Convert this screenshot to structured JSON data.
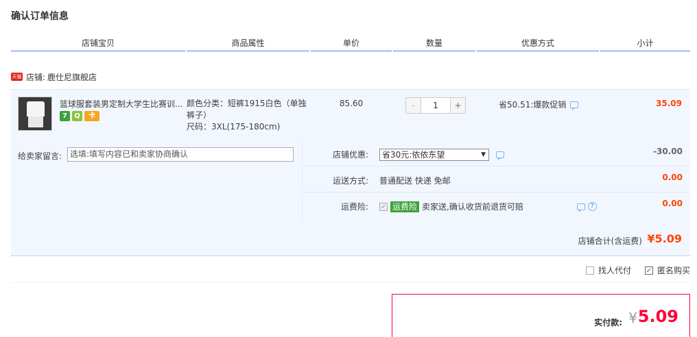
{
  "page": {
    "title": "确认订单信息"
  },
  "columns": [
    "店铺宝贝",
    "商品属性",
    "单价",
    "数量",
    "优惠方式",
    "小计"
  ],
  "shop": {
    "badge": "天猫",
    "label": "店铺:",
    "name": "鹿仕尼旗舰店"
  },
  "item": {
    "name": "篮球服套装男定制大学生比赛训...",
    "tags": [
      "7",
      "Q",
      "卡"
    ],
    "color_prop": "颜色分类：短裤1915白色（单独裤子）",
    "size_prop": "尺码：3XL(175-180cm)",
    "price": "85.60",
    "quantity": "1",
    "qty_minus": "-",
    "qty_plus": "+",
    "promo": "省50.51:爆款促销",
    "subtotal": "35.09"
  },
  "memo": {
    "label": "给卖家留言:",
    "placeholder": "选填:填写内容已和卖家协商确认"
  },
  "options": {
    "discount": {
      "label": "店铺优惠:",
      "selected": "省30元:依依东望",
      "amount": "-30.00"
    },
    "shipping": {
      "label": "运送方式:",
      "value": "普通配送 快递 免邮",
      "amount": "0.00"
    },
    "insurance": {
      "label": "运费险:",
      "badge": "运费险",
      "text": "卖家送,确认收货前退货可赔",
      "amount": "0.00"
    }
  },
  "shop_total": {
    "label": "店铺合计(含运费)",
    "value": "¥5.09"
  },
  "pay_options": {
    "proxy_pay": "找人代付",
    "anonymous": "匿名购买"
  },
  "final": {
    "label": "实付款:",
    "currency": "¥",
    "value": "5.09"
  },
  "colors": {
    "accent_red": "#ff4400",
    "header_line": "#b2d1ff",
    "row_bg": "#f2f7ff",
    "final_border": "#ff0036"
  }
}
